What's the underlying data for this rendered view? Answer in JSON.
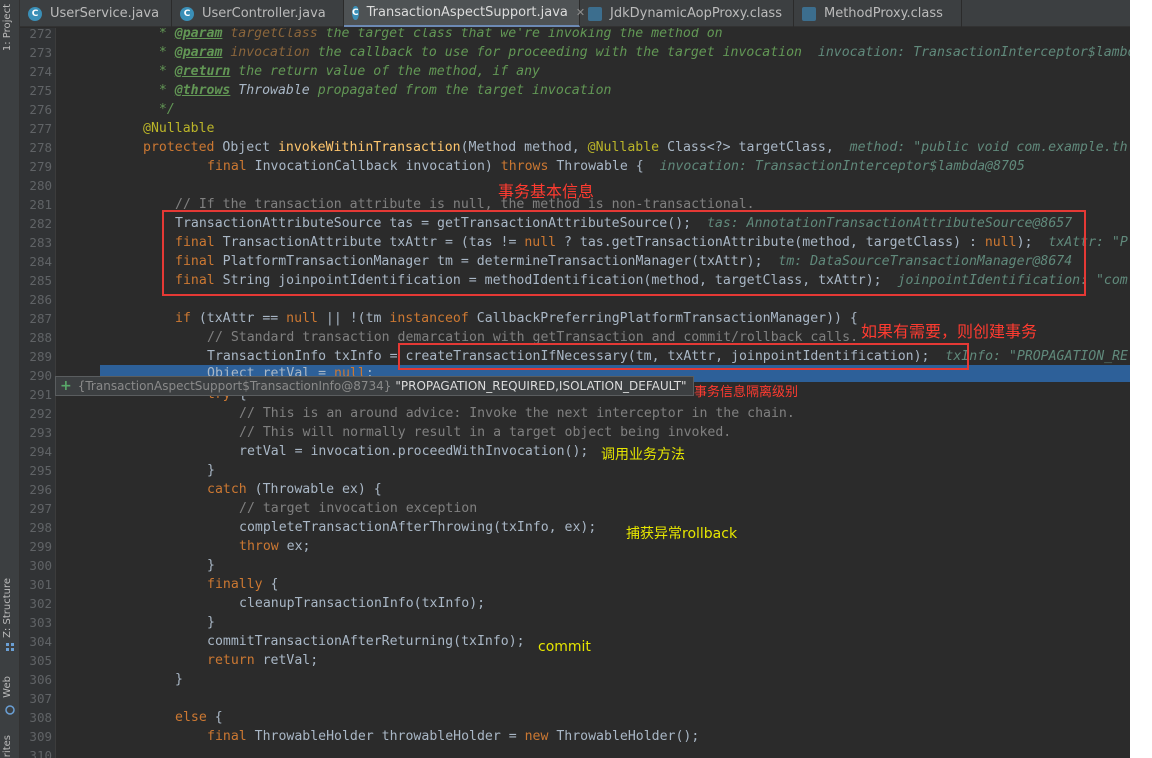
{
  "tool_strip": {
    "project": "1: Project",
    "structure": "Z: Structure",
    "web": "Web",
    "favorites": "rites"
  },
  "tabs": [
    {
      "label": "UserService.java",
      "icon": "C",
      "active": false
    },
    {
      "label": "UserController.java",
      "icon": "C",
      "active": false
    },
    {
      "label": "TransactionAspectSupport.java",
      "icon": "C",
      "active": true
    },
    {
      "label": "JdkDynamicAopProxy.class",
      "icon": "class-file-icon",
      "active": false
    },
    {
      "label": "MethodProxy.class",
      "icon": "class-file-icon",
      "active": false
    }
  ],
  "line_numbers": [
    "272",
    "273",
    "274",
    "275",
    "276",
    "277",
    "278",
    "279",
    "280",
    "281",
    "282",
    "283",
    "284",
    "285",
    "286",
    "287",
    "288",
    "289",
    "290",
    "291",
    "292",
    "293",
    "294",
    "295",
    "296",
    "297",
    "298",
    "299",
    "300",
    "301",
    "302",
    "303",
    "304",
    "305",
    "306",
    "307",
    "308",
    "309",
    "310"
  ],
  "code": {
    "l272": {
      "a": "  * ",
      "tag": "@param",
      "p": " targetClass",
      "d": " the target class that we're invoking the method on"
    },
    "l273": {
      "a": "  * ",
      "tag": "@param",
      "p": " invocation",
      "d": " the callback to use for proceeding with the target invocation",
      "hint": "  invocation: TransactionInterceptor$lambda@8705"
    },
    "l274": {
      "a": "  * ",
      "tag": "@return",
      "d": " the return value of the method, if any"
    },
    "l275": {
      "a": "  * ",
      "tag": "@throws",
      "p": " Throwable",
      "d": " propagated from the target invocation"
    },
    "l276": "  */",
    "l277": "@Nullable",
    "l278": {
      "kw": "protected ",
      "t": "Object ",
      "fn": "invokeWithinTransaction",
      "rest1": "(Method method, ",
      "an": "@Nullable",
      "rest2": " Class<?> targetClass,",
      "hint": "  method: \"public void com.example.th"
    },
    "l279": {
      "kw": "final ",
      "t": "InvocationCallback invocation) ",
      "kw2": "throws ",
      "t2": "Throwable {",
      "hint": "  invocation: TransactionInterceptor$lambda@8705"
    },
    "l281": "// If the transaction attribute is null, the method is non-transactional.",
    "l282": {
      "t": "TransactionAttributeSource tas = getTransactionAttributeSource();",
      "hint": "  tas: AnnotationTransactionAttributeSource@8657"
    },
    "l283": {
      "kw": "final ",
      "t": "TransactionAttribute txAttr = (tas != ",
      "kw2": "null",
      "t2": " ? tas.getTransactionAttribute(method, targetClass) : ",
      "kw3": "null",
      "t3": ");",
      "hint": "  txAttr: \"P"
    },
    "l284": {
      "kw": "final ",
      "t": "PlatformTransactionManager tm = determineTransactionManager(txAttr);",
      "hint": "  tm: DataSourceTransactionManager@8674"
    },
    "l285": {
      "kw": "final ",
      "t": "String joinpointIdentification = methodIdentification(method, targetClass, txAttr);",
      "hint": "  joinpointIdentification: \"com"
    },
    "l287": {
      "kw": "if ",
      "t": "(txAttr == ",
      "kw2": "null",
      "t2": " || !(tm ",
      "kw3": "instanceof",
      "t3": " CallbackPreferringPlatformTransactionManager)) {"
    },
    "l288": "// Standard transaction demarcation with getTransaction and commit/rollback calls.",
    "l289": {
      "t": "TransactionInfo txInfo = createTransactionIfNecessary(tm, txAttr, joinpointIdentification);",
      "hint": "  txInfo: \"PROPAGATION_RE"
    },
    "l290": {
      "t": "Object retVal = ",
      "kw": "null",
      "t2": ";"
    },
    "l291": {
      "kw": "try",
      "t": " {"
    },
    "l292": "// This is an around advice: Invoke the next interceptor in the chain.",
    "l293": "// This will normally result in a target object being invoked.",
    "l294": "retVal = invocation.proceedWithInvocation();",
    "l295": "}",
    "l296": {
      "kw": "catch",
      "t": " (Throwable ex) {"
    },
    "l297": "// target invocation exception",
    "l298": "completeTransactionAfterThrowing(txInfo, ex);",
    "l299": {
      "kw": "throw",
      "t": " ex;"
    },
    "l300": "}",
    "l301": {
      "kw": "finally",
      "t": " {"
    },
    "l302": "cleanupTransactionInfo(txInfo);",
    "l303": "}",
    "l304": "commitTransactionAfterReturning(txInfo);",
    "l305": {
      "kw": "return",
      "t": " retVal;"
    },
    "l306": "}",
    "l308": {
      "kw": "else",
      "t": " {"
    },
    "l309": {
      "kw": "final",
      "t": " ThrowableHolder throwableHolder = ",
      "kw2": "new",
      "t2": " ThrowableHolder();"
    }
  },
  "debug_tooltip": {
    "type": "{TransactionAspectSupport$TransactionInfo@8734}",
    "value": "\"PROPAGATION_REQUIRED,ISOLATION_DEFAULT\""
  },
  "annotations": {
    "basic_info": "事务基本信息",
    "create_if_needed": "如果有需要，则创建事务",
    "isolation_level": "事务信息隔离级别",
    "invoke_business": "调用业务方法",
    "catch_rollback": "捕获异常rollback",
    "commit": "commit"
  },
  "colors": {
    "keyword": "#cc7832",
    "annotation": "#bbb529",
    "method": "#ffc66d",
    "comment": "#808080",
    "doc": "#629755",
    "highlight_box": "#e53935"
  }
}
